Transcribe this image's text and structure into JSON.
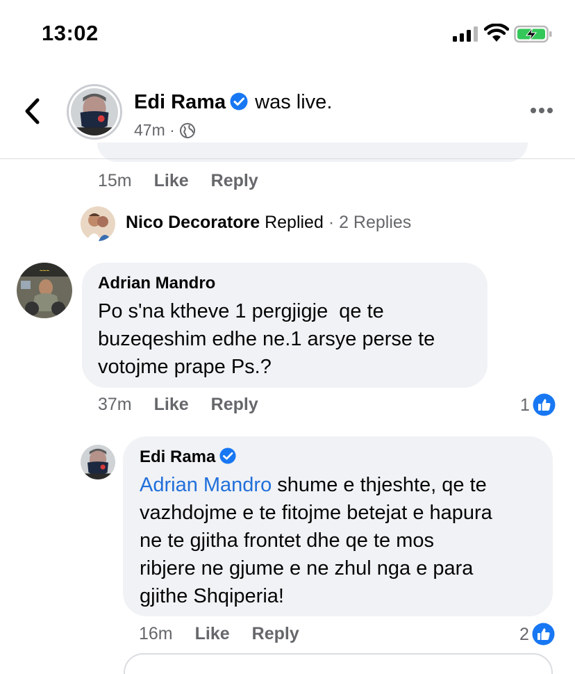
{
  "status_bar": {
    "time": "13:02"
  },
  "header": {
    "name": "Edi Rama",
    "suffix": "was live.",
    "time": "47m",
    "separator": "·",
    "icons": [
      "back-icon",
      "verified-icon",
      "globe-icon",
      "more-icon"
    ]
  },
  "prev_comment": {
    "time": "15m",
    "like_label": "Like",
    "reply_label": "Reply"
  },
  "replies_summary": {
    "name": "Nico Decoratore",
    "action": "Replied",
    "count_text": "· 2 Replies"
  },
  "comments": [
    {
      "author": "Adrian Mandro",
      "text_lines": [
        "Po s'na ktheve 1 pergjigje  qe te",
        "buzeqeshim edhe ne.1 arsye perse te",
        "votojme prape Ps.?"
      ],
      "time": "37m",
      "like_label": "Like",
      "reply_label": "Reply",
      "reactions": "1"
    },
    {
      "author": "Edi Rama",
      "mention": "Adrian Mandro",
      "text_first": "shume e thjeshte, qe te",
      "text_lines": [
        "vazhdojme e te fitojme betejat e hapura",
        "ne te gjitha frontet dhe qe te mos",
        "ribjere ne gjume e ne zhul nga e para",
        "gjithe Shqiperia!"
      ],
      "time": "16m",
      "like_label": "Like",
      "reply_label": "Reply",
      "reactions": "2"
    }
  ],
  "colors": {
    "accent": "#1877f2",
    "mention": "#216fdb",
    "bubble": "#f0f2f5",
    "meta": "#65676b",
    "battery": "#34c759"
  }
}
